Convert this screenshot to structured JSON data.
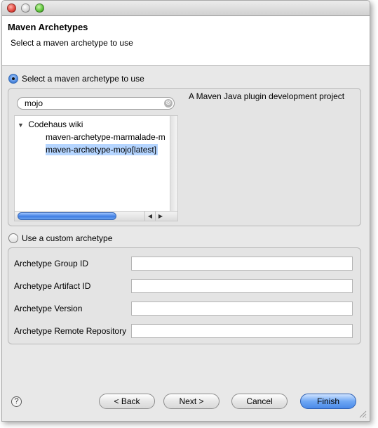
{
  "window": {
    "title": ""
  },
  "header": {
    "title": "Maven Archetypes",
    "subtitle": "Select a maven archetype to use"
  },
  "archetype_choice": {
    "select_label": "Select a maven archetype to use",
    "select_checked": true,
    "custom_label": "Use a custom archetype",
    "custom_checked": false
  },
  "search": {
    "value": "mojo",
    "clear_glyph": "⊗"
  },
  "tree": {
    "group": {
      "label": "Codehaus wiki",
      "expanded": true
    },
    "items": [
      {
        "label": "maven-archetype-marmalade-m",
        "selected": false
      },
      {
        "label": "maven-archetype-mojo[latest]",
        "selected": true
      }
    ]
  },
  "description": "A Maven Java plugin development project",
  "custom_fields": [
    {
      "label": "Archetype Group ID",
      "value": ""
    },
    {
      "label": "Archetype Artifact ID",
      "value": ""
    },
    {
      "label": "Archetype Version",
      "value": ""
    },
    {
      "label": "Archetype Remote Repository",
      "value": ""
    }
  ],
  "buttons": {
    "help": "?",
    "back": "< Back",
    "next": "Next >",
    "cancel": "Cancel",
    "finish": "Finish"
  },
  "colors": {
    "selection": "#b5d5ff",
    "default_button": "#4a8ae8"
  }
}
